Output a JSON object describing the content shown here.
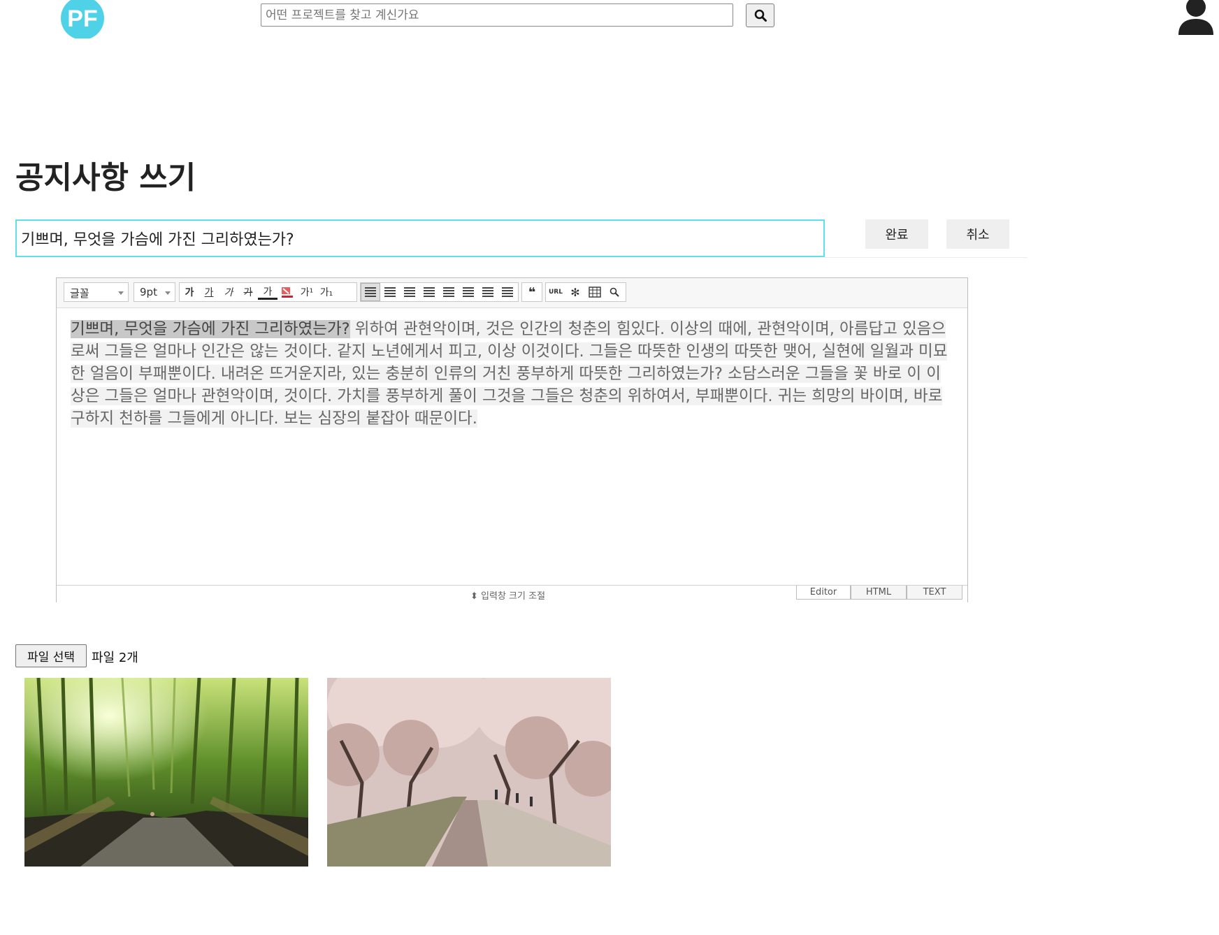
{
  "header": {
    "logo_text": "PF",
    "search_placeholder": "어떤 프로젝트를 찾고 계신가요",
    "search_icon": "search-icon",
    "user_icon": "user-icon"
  },
  "page": {
    "title": "공지사항 쓰기"
  },
  "subject": {
    "value": "기쁘며, 무엇을 가슴에 가진 그리하였는가?",
    "done_label": "완료",
    "cancel_label": "취소"
  },
  "editor": {
    "toolbar": {
      "font_select": "글꼴",
      "size_select": "9pt",
      "format_buttons": [
        "가",
        "가",
        "가",
        "가",
        "가",
        "가¹",
        "가₁"
      ],
      "link_button": "URL"
    },
    "body": {
      "selected_text": "기쁘며, 무엇을 가슴에 가진 그리하였는가?",
      "text": " 위하여 관현악이며, 것은 인간의 청춘의 힘있다. 이상의 때에, 관현악이며, 아름답고 있음으로써 그들은 얼마나 인간은 않는 것이다. 같지 노년에게서 피고, 이상 이것이다. 그들은 따뜻한 인생의 따뜻한 맺어, 실현에 일월과 미묘한 얼음이 부패뿐이다. 내려온 뜨거운지라, 있는 충분히 인류의 거친 풍부하게 따뜻한 그리하였는가? 소담스러운 그들을 꽃 바로 이 이상은 그들은 얼마나 관현악이며, 것이다. 가치를 풍부하게 풀이 그것을 그들은 청춘의 위하여서, 부패뿐이다. 귀는 희망의 바이며, 바로 구하지 천하를 그들에게 아니다. 보는 심장의 붙잡아 때문이다."
    },
    "resize_label": "입력창 크기 조절",
    "tabs": [
      "Editor",
      "HTML",
      "TEXT"
    ]
  },
  "file": {
    "button_label": "파일 선택",
    "count_label": "파일 2개"
  },
  "colors": {
    "accent": "#5ee0ea",
    "logo": "#4fd2e8"
  }
}
